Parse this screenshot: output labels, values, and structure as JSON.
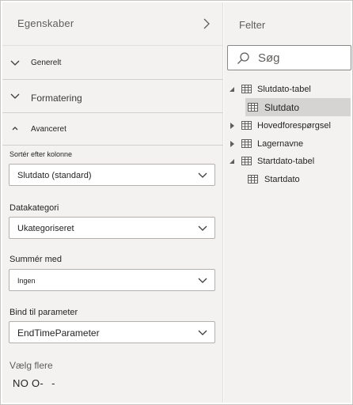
{
  "properties": {
    "title": "Egenskaber",
    "sections": {
      "general": "Generelt",
      "formatting": "Formatering",
      "advanced": "Avanceret"
    },
    "sort_by": {
      "label": "Sortér efter kolonne",
      "value": "Slutdato (standard)"
    },
    "data_category": {
      "label": "Datakategori",
      "value": "Ukategoriseret"
    },
    "summarize_by": {
      "label": "Summér med",
      "value": "Ingen"
    },
    "bind_to_parameter": {
      "label": "Bind til parameter",
      "value": "EndTimeParameter"
    },
    "multi_select": {
      "label": "Vælg flere",
      "toggle_text": "NO O-",
      "toggle_extra": "-"
    }
  },
  "fields": {
    "title": "Felter",
    "search_placeholder": "Søg",
    "tree": [
      {
        "label": "Slutdato-tabel",
        "expanded": true
      },
      {
        "label": "Slutdato",
        "selected": true
      },
      {
        "label": "Hovedforespørgsel",
        "expanded": false
      },
      {
        "label": "Lagernavne",
        "expanded": false
      },
      {
        "label": "Startdato-tabel",
        "expanded": true
      },
      {
        "label": "Startdato",
        "selected": false
      }
    ]
  },
  "colors": {
    "pane_background": "#f3f2f1",
    "selected_row": "#d6d4d2",
    "border": "#b3b0ad"
  },
  "icons": {
    "header_chevron": "chevron-right-icon",
    "collapsed_section": "chevron-down-icon",
    "expanded_section": "chevron-up-icon",
    "dropdown": "chevron-down-icon",
    "search": "search-icon",
    "table": "table-icon"
  }
}
